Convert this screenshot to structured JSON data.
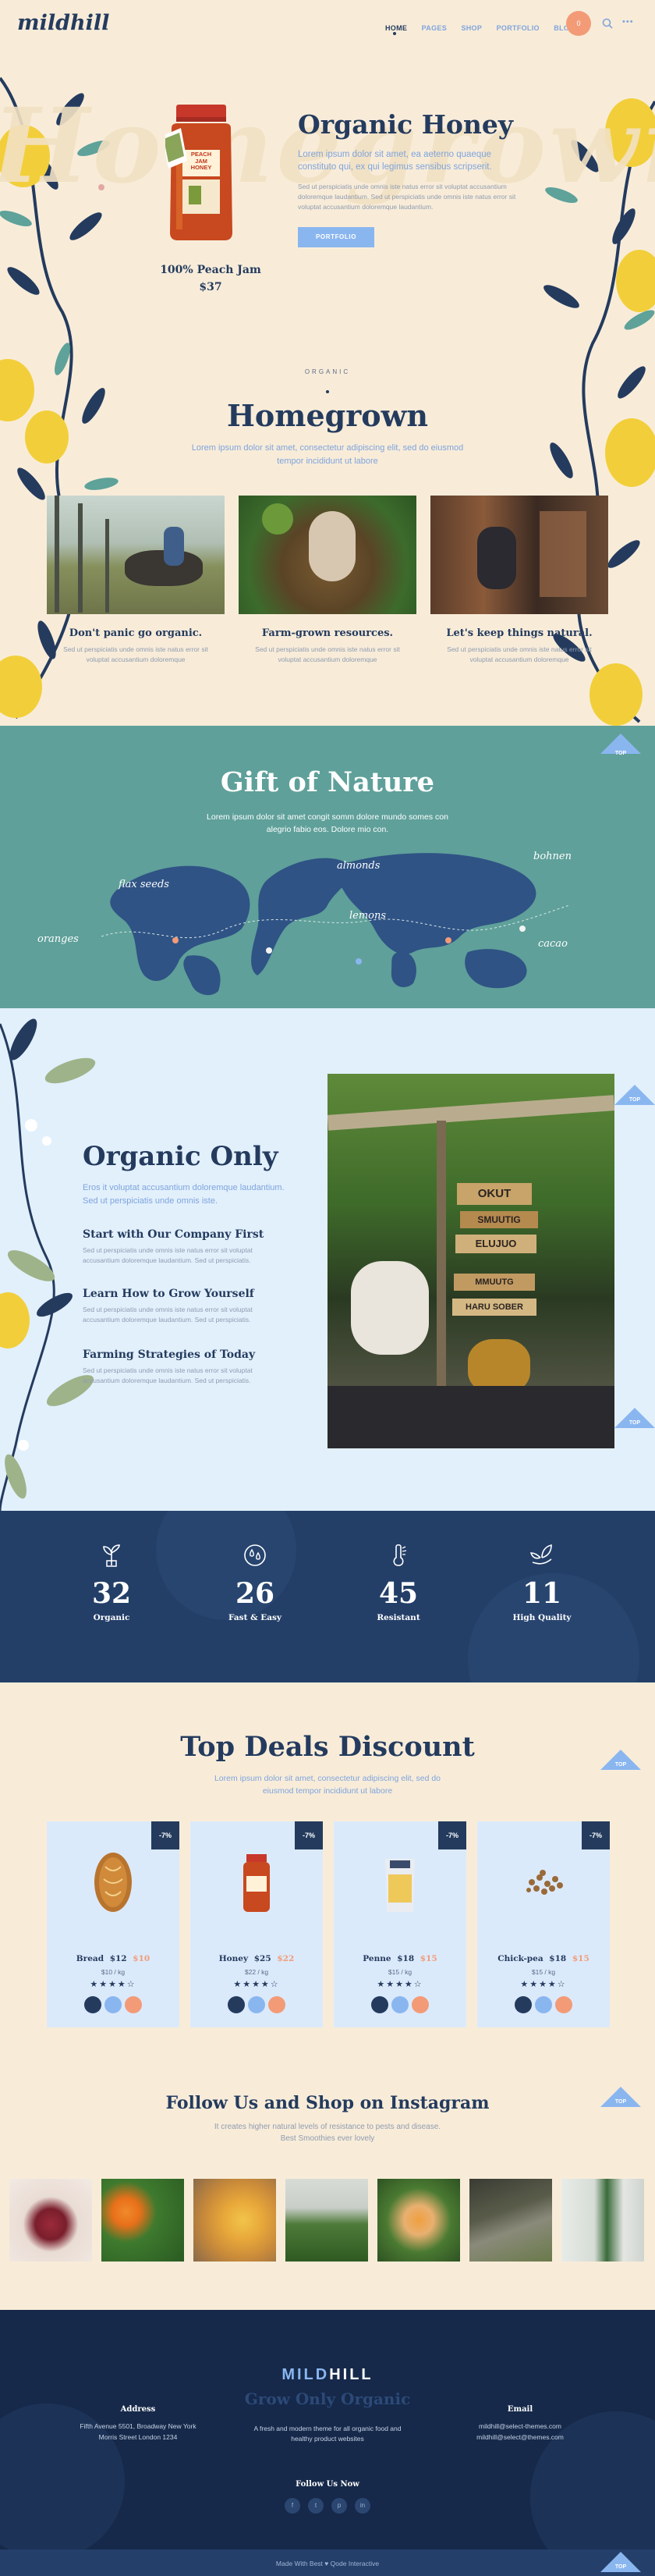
{
  "nav": {
    "logo": "mildhill",
    "links": [
      "HOME",
      "PAGES",
      "SHOP",
      "PORTFOLIO",
      "BLOG"
    ],
    "cart_count": "0",
    "more": "•••"
  },
  "hero": {
    "watermark": "Homegrown",
    "title": "Organic Honey",
    "lead": "Lorem ipsum dolor sit amet, ea aeterno quaeque constituto qui, ex qui legimus sensibus scripserit.",
    "body": "Sed ut perspiciatis unde omnis iste natus error sit voluptat accusantium doloremque laudantium. Sed ut perspiciatis unde omnis iste natus error sit voluptat accusantium doloremque laudantium.",
    "button": "PORTFOLIO",
    "product_name": "100% Peach Jam",
    "product_price": "$37",
    "jar_label": "PEACH JAM HONEY"
  },
  "homegrown": {
    "eyebrow": "ORGANIC",
    "title": "Homegrown",
    "subtitle": "Lorem ipsum dolor sit amet, consectetur adipiscing elit, sed do eiusmod tempor incididunt ut labore",
    "features": [
      {
        "title": "Don't panic go organic.",
        "text": "Sed ut perspiciatis unde omnis iste natus error sit voluptat accusantium doloremque"
      },
      {
        "title": "Farm-grown resources.",
        "text": "Sed ut perspiciatis unde omnis iste natus error sit voluptat accusantium doloremque"
      },
      {
        "title": "Let's keep things natural.",
        "text": "Sed ut perspiciatis unde omnis iste natus error sit voluptat accusantium doloremque"
      }
    ]
  },
  "gift": {
    "title": "Gift of Nature",
    "subtitle": "Lorem ipsum dolor sit amet congit somm dolore mundo somes con alegrio fabio eos. Dolore mio con.",
    "labels": [
      "flax seeds",
      "almonds",
      "lemons",
      "oranges",
      "bohnen",
      "cacao"
    ],
    "top": "TOP"
  },
  "organic": {
    "title": "Organic Only",
    "lead": "Eros it voluptat accusantium doloremque laudantium. Sed ut perspiciatis unde omnis iste.",
    "items": [
      {
        "title": "Start with Our Company First",
        "text": "Sed ut perspiciatis unde omnis iste natus error sit voluptat accusantium doloremque laudantium. Sed ut perspiciatis."
      },
      {
        "title": "Learn How to Grow Yourself",
        "text": "Sed ut perspiciatis unde omnis iste natus error sit voluptat accusantium doloremque laudantium. Sed ut perspiciatis."
      },
      {
        "title": "Farming Strategies of Today",
        "text": "Sed ut perspiciatis unde omnis iste natus error sit voluptat accusantium doloremque laudantium. Sed ut perspiciatis."
      }
    ],
    "signs": [
      "OKUT",
      "SMUUTIG",
      "ELUJUO",
      "MMUUTG",
      "HARU SOBER"
    ],
    "top": "TOP"
  },
  "stats": [
    {
      "value": "32",
      "label": "Organic",
      "icon": "plant-icon"
    },
    {
      "value": "26",
      "label": "Fast & Easy",
      "icon": "drops-icon"
    },
    {
      "value": "45",
      "label": "Resistant",
      "icon": "thermometer-icon"
    },
    {
      "value": "11",
      "label": "High Quality",
      "icon": "leaves-hand-icon"
    }
  ],
  "deals": {
    "title": "Top Deals Discount",
    "subtitle": "Lorem ipsum dolor sit amet, consectetur adipiscing elit, sed do eiusmod tempor incididunt ut labore",
    "top": "TOP",
    "products": [
      {
        "name": "Bread",
        "price": "$12",
        "old": "$10",
        "unit": "$10 / kg",
        "badge": "-7%",
        "rating": "★★★★☆"
      },
      {
        "name": "Honey",
        "price": "$25",
        "old": "$22",
        "unit": "$22 / kg",
        "badge": "-7%",
        "rating": "★★★★☆"
      },
      {
        "name": "Penne",
        "price": "$18",
        "old": "$15",
        "unit": "$15 / kg",
        "badge": "-7%",
        "rating": "★★★★☆"
      },
      {
        "name": "Chick-pea",
        "price": "$18",
        "old": "$15",
        "unit": "$15 / kg",
        "badge": "-7%",
        "rating": "★★★★☆"
      }
    ]
  },
  "instagram": {
    "title": "Follow Us and Shop on Instagram",
    "subtitle": "It creates higher natural levels of resistance to pests and disease. Best Smoothies ever lovely",
    "top": "TOP"
  },
  "footer": {
    "logo_left": "MILD",
    "logo_right": "HILL",
    "tagline": "Grow Only Organic",
    "address_title": "Address",
    "address_1": "Fifth Avenue 5501, Broadway New York",
    "address_2": "Morris Street London 1234",
    "about": "A fresh and modern theme for all organic food and healthy product websites",
    "email_title": "Email",
    "email_1": "mildhill@select-themes.com",
    "email_2": "mildhill@select@themes.com",
    "follow": "Follow Us Now",
    "socials": [
      "f",
      "t",
      "p",
      "in"
    ],
    "copyright": "Made With Best ♥ Qode Interactive",
    "top": "TOP"
  }
}
